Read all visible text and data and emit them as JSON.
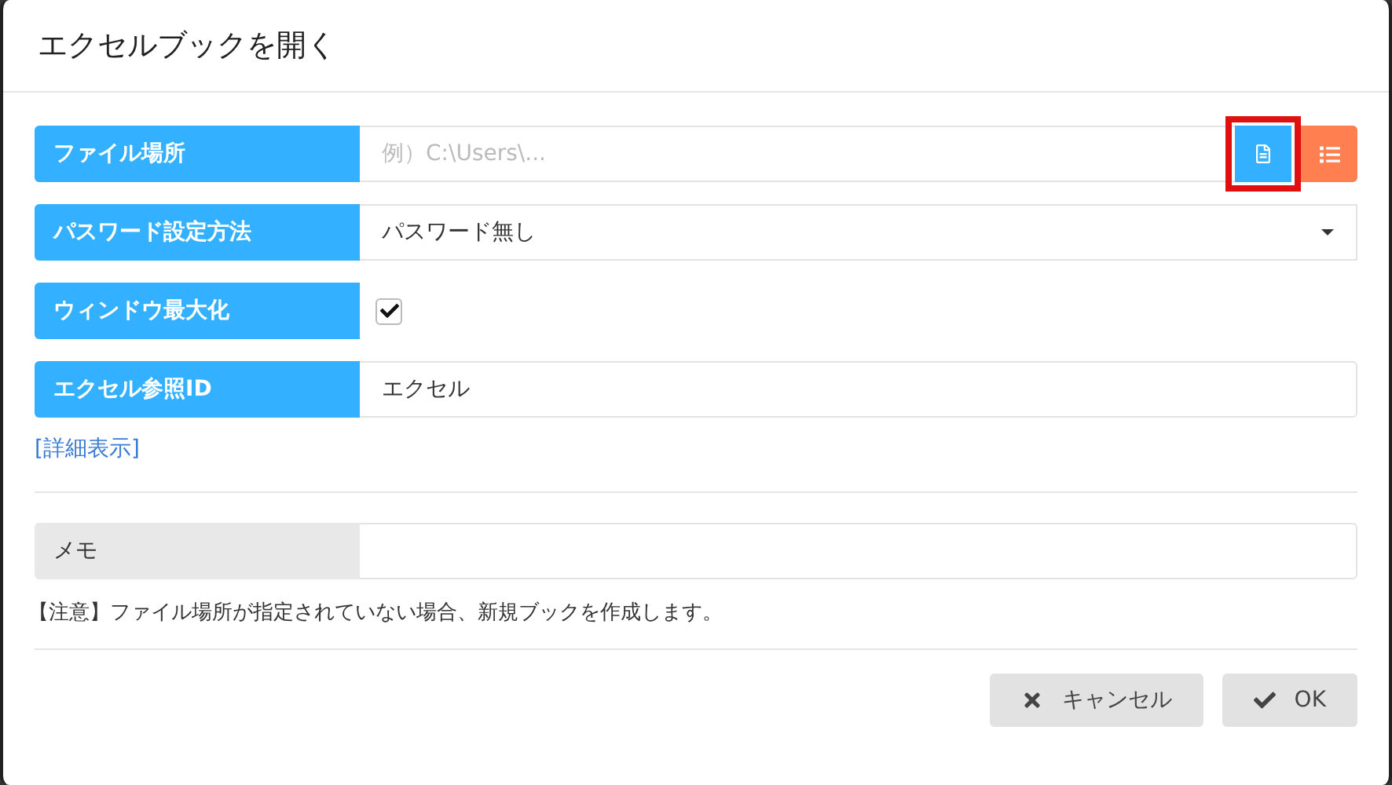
{
  "dialog": {
    "title": "エクセルブックを開く"
  },
  "fields": [
    {
      "kind": "path",
      "label": "ファイル場所",
      "placeholder": "例）C:\\Users\\...",
      "buttons": [
        {
          "kind": "file",
          "highlighted": true
        },
        {
          "kind": "list",
          "highlighted": false
        }
      ]
    },
    {
      "kind": "select",
      "label": "パスワード設定方法",
      "value": "パスワード無し"
    },
    {
      "kind": "checkbox",
      "label": "ウィンドウ最大化",
      "checked": true
    },
    {
      "kind": "text",
      "label": "エクセル参照ID",
      "value": "エクセル"
    }
  ],
  "details_link": "[詳細表示]",
  "memo": {
    "label": "メモ"
  },
  "note": "【注意】ファイル場所が指定されていない場合、新規ブックを作成します。",
  "buttons": [
    {
      "kind": "cancel",
      "label": "キャンセル"
    },
    {
      "kind": "ok",
      "label": "OK"
    }
  ]
}
